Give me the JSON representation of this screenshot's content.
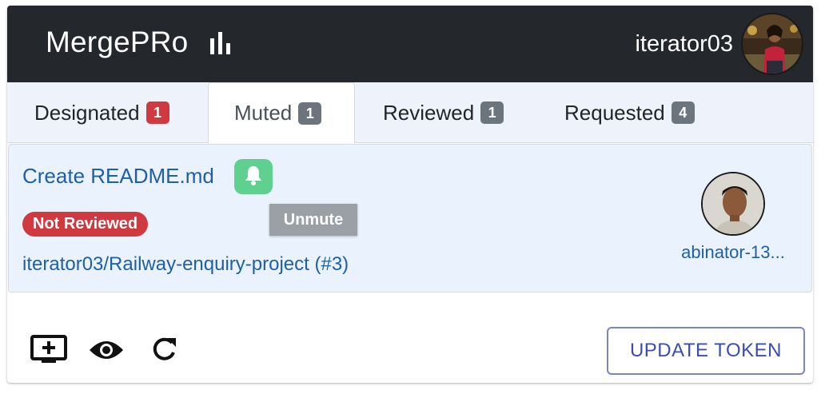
{
  "header": {
    "brand": "MergePRo",
    "username": "iterator03"
  },
  "tabs": [
    {
      "label": "Designated",
      "count": "1",
      "badge_color": "#d0393f"
    },
    {
      "label": "Muted",
      "count": "1",
      "badge_color": "#6c757d",
      "active": true
    },
    {
      "label": "Reviewed",
      "count": "1",
      "badge_color": "#6c757d"
    },
    {
      "label": "Requested",
      "count": "4",
      "badge_color": "#6c757d"
    }
  ],
  "pull_request": {
    "title": "Create README.md",
    "tooltip": "Unmute",
    "status": "Not Reviewed",
    "repo": "iterator03/Railway-enquiry-project (#3)",
    "author": "abinator-13..."
  },
  "footer": {
    "icons": [
      "add-to-screen-icon",
      "eye-icon",
      "refresh-icon"
    ],
    "update_button": "UPDATE TOKEN"
  },
  "colors": {
    "header_bg": "#24272b",
    "link": "#1f5fa8",
    "danger": "#d0393f",
    "muted_badge": "#6c757d",
    "bell_green": "#5fd08f",
    "button_text": "#3b4cb4"
  }
}
